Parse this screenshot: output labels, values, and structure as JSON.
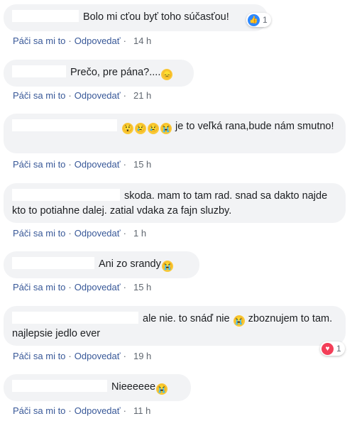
{
  "actions": {
    "like": "Páči sa mi to",
    "reply": "Odpovedať",
    "sep": "·"
  },
  "comments": [
    {
      "text": "Bolo mi cťou byť toho súčasťou!",
      "emojis": [],
      "time": "14 h",
      "reaction": {
        "type": "like",
        "count": "1"
      }
    },
    {
      "text": "Prečo, pre pána?....",
      "emojis": [
        "disappointed-face"
      ],
      "time": "21 h"
    },
    {
      "text_before": "",
      "emojis": [
        "astonished-face",
        "crying-face",
        "crying-face",
        "loudly-crying-face"
      ],
      "text": "je to veľká rana,bude nám smutno!",
      "time": "15 h"
    },
    {
      "text": "skoda. mam to tam rad. snad sa dakto najde kto to potiahne dalej. zatial vdaka za fajn sluzby.",
      "time": "1 h"
    },
    {
      "text": "Ani zo srandy",
      "emojis_after": [
        "loudly-crying-face"
      ],
      "time": "15 h"
    },
    {
      "text_a": "ale nie. to snáď nie",
      "emojis_mid": [
        "loudly-crying-face"
      ],
      "text_b": "zboznujem to tam. najlepsie jedlo ever",
      "time": "19 h",
      "reaction": {
        "type": "love",
        "count": "1"
      }
    },
    {
      "text": "Nieeeeee",
      "emojis_after": [
        "loudly-crying-face"
      ],
      "time": "11 h"
    }
  ],
  "icons": {
    "like": "like-icon",
    "love": "heart-icon"
  },
  "colors": {
    "bubble": "#f2f3f5",
    "link": "#385898",
    "like": "#2d88ff",
    "love": "#f33e58"
  }
}
